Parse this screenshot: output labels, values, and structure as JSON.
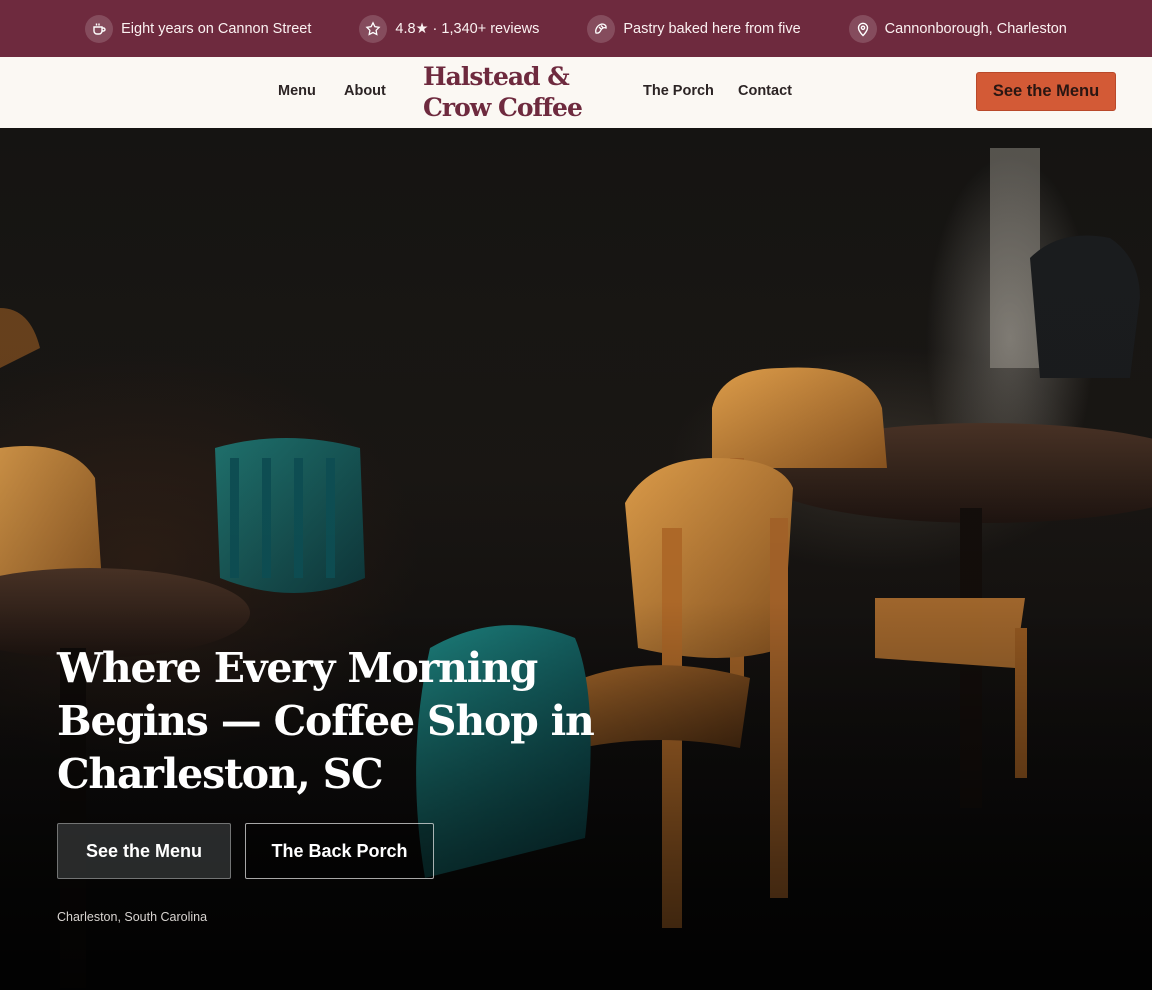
{
  "topbar": {
    "items": [
      {
        "icon": "coffee-cup-icon",
        "text": "Eight years on Cannon Street"
      },
      {
        "icon": "star-icon",
        "text": "4.8★ · 1,340+ reviews"
      },
      {
        "icon": "croissant-icon",
        "text": "Pastry baked here from five"
      },
      {
        "icon": "map-pin-icon",
        "text": "Cannonborough, Charleston"
      }
    ]
  },
  "header": {
    "nav": [
      "Menu",
      "About",
      "The Porch",
      "Contact"
    ],
    "logo_line1": "Halstead &",
    "logo_line2": "Crow Coffee",
    "cta_label": "See the Menu"
  },
  "hero": {
    "title": "Where Every Morning Begins — Coffee Shop in Charleston, SC",
    "primary_label": "See the Menu",
    "secondary_label": "The Back Porch",
    "location": "Charleston, South Carolina"
  },
  "colors": {
    "topbar_bg": "#6e2a3e",
    "header_bg": "#fbf8f3",
    "logo": "#6e2a3e",
    "cta_bg": "#d35a36"
  }
}
